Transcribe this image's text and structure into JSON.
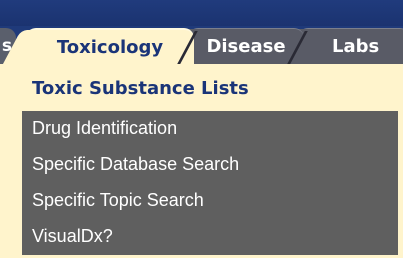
{
  "tabs": {
    "partial_label": "s",
    "active_label": "Toxicology",
    "disease_label": "Disease",
    "labs_label": "Labs"
  },
  "menu": {
    "heading": "Toxic Substance Lists",
    "items": [
      {
        "label": "Drug Identification"
      },
      {
        "label": "Specific Database Search"
      },
      {
        "label": "Specific Topic Search"
      },
      {
        "label": "VisualDx?"
      }
    ]
  },
  "colors": {
    "navy": "#1f3a7a",
    "cream": "#fff4cc",
    "tab_gray": "#595b66",
    "menu_gray": "#5f5f5f",
    "heading_blue": "#1a3478"
  }
}
